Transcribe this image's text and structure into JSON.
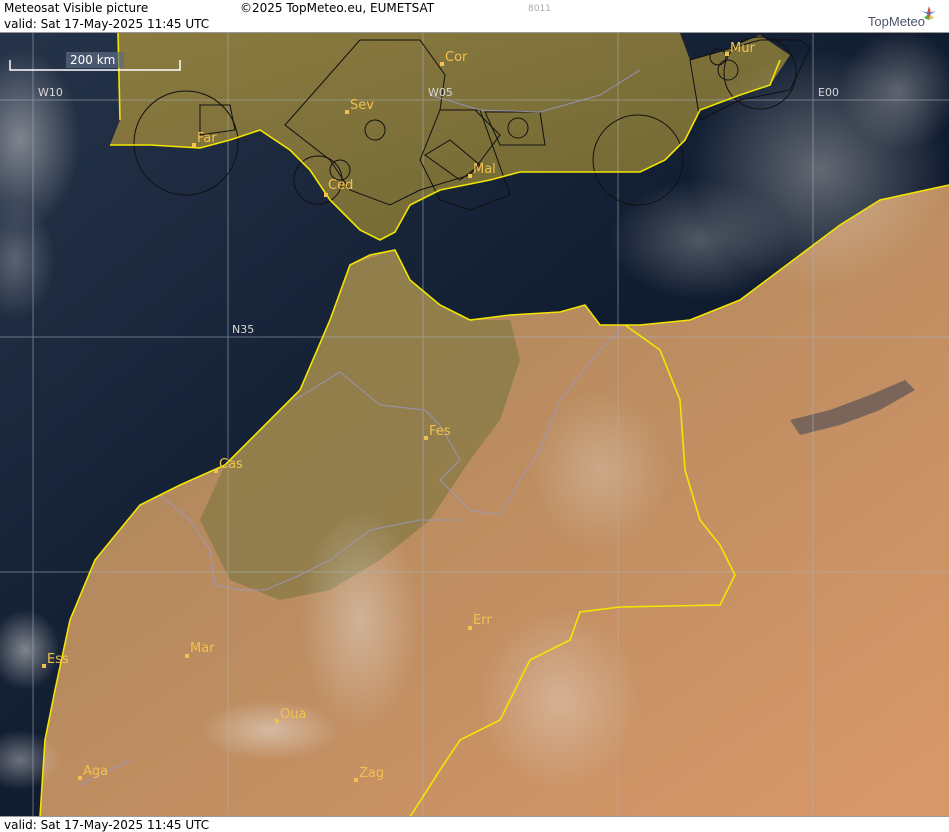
{
  "header": {
    "title": "Meteosat Visible picture",
    "valid": "valid:  Sat  17-May-2025  11:45 UTC",
    "copyright": "©2025 TopMeteo.eu, EUMETSAT",
    "code": "8011",
    "logo_text": "TopMeteo"
  },
  "footer": {
    "valid": "valid:  Sat  17-May-2025  11:45 UTC"
  },
  "scale": {
    "label": "200 km"
  },
  "grid_labels": {
    "w10": "W10",
    "w05": "W05",
    "e00": "E00",
    "n35": "N35"
  },
  "cities": {
    "cor": "Cor",
    "mur": "Mur",
    "sev": "Sev",
    "far": "Far",
    "ced": "Ced",
    "mal": "Mal",
    "fes": "Fes",
    "cas": "Cas",
    "err": "Err",
    "ess": "Ess",
    "mar": "Mar",
    "oua": "Oua",
    "aga": "Aga",
    "zag": "Zag"
  },
  "colors": {
    "sea": "#0e1b2e",
    "land_iberia": "#7a6a35",
    "land_desert": "#c48a5e",
    "border": "#f2e600",
    "city": "#f2c14e"
  }
}
